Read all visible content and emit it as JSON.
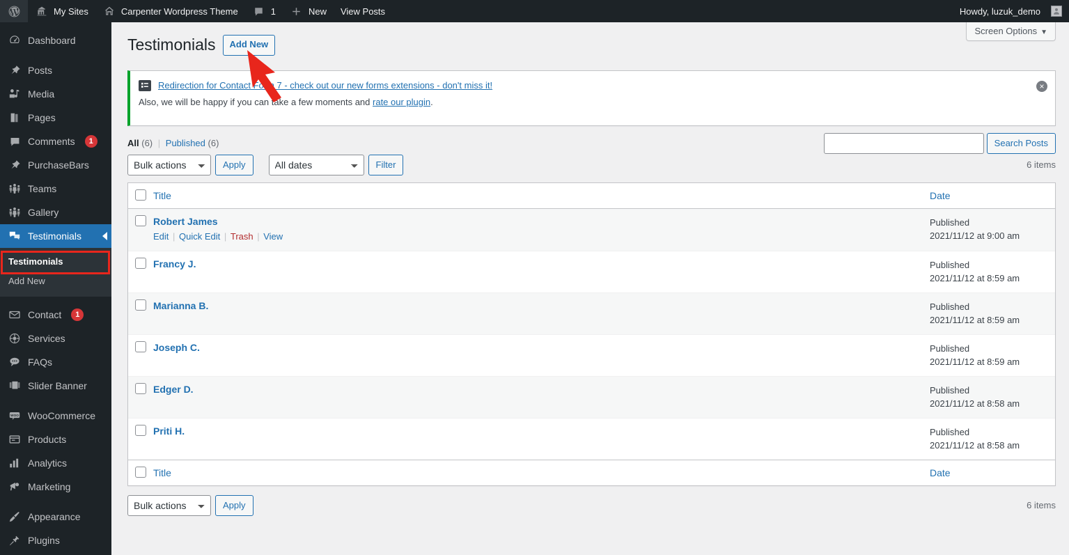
{
  "adminbar": {
    "wp_logo": "wordpress-logo-icon",
    "items": [
      {
        "label": "My Sites",
        "icon": "sites-icon"
      },
      {
        "label": "Carpenter Wordpress Theme",
        "icon": "home-icon"
      },
      {
        "label": "1",
        "icon": "comment-bubble-icon"
      },
      {
        "label": "New",
        "icon": "plus-icon"
      },
      {
        "label": "View Posts",
        "icon": ""
      }
    ],
    "howdy": "Howdy, luzuk_demo",
    "avatar": "user-avatar-icon"
  },
  "sidebar": {
    "items": [
      {
        "label": "Dashboard",
        "icon": "dashboard-icon",
        "badge": "",
        "current": false
      },
      {
        "label": "Posts",
        "icon": "pin-icon",
        "badge": "",
        "current": false
      },
      {
        "label": "Media",
        "icon": "media-icon",
        "badge": "",
        "current": false
      },
      {
        "label": "Pages",
        "icon": "pages-icon",
        "badge": "",
        "current": false
      },
      {
        "label": "Comments",
        "icon": "comment-bubble-icon",
        "badge": "1",
        "current": false
      },
      {
        "label": "PurchaseBars",
        "icon": "pin-icon",
        "badge": "",
        "current": false
      },
      {
        "label": "Teams",
        "icon": "groups-icon",
        "badge": "",
        "current": false
      },
      {
        "label": "Gallery",
        "icon": "groups-icon",
        "badge": "",
        "current": false
      },
      {
        "label": "Testimonials",
        "icon": "testimonials-icon",
        "badge": "",
        "current": true
      },
      {
        "label": "Contact",
        "icon": "email-icon",
        "badge": "1",
        "current": false
      },
      {
        "label": "Services",
        "icon": "services-icon",
        "badge": "",
        "current": false
      },
      {
        "label": "FAQs",
        "icon": "faq-icon",
        "badge": "",
        "current": false
      },
      {
        "label": "Slider Banner",
        "icon": "slider-icon",
        "badge": "",
        "current": false
      },
      {
        "label": "WooCommerce",
        "icon": "woocommerce-icon",
        "badge": "",
        "current": false
      },
      {
        "label": "Products",
        "icon": "products-icon",
        "badge": "",
        "current": false
      },
      {
        "label": "Analytics",
        "icon": "analytics-bars-icon",
        "badge": "",
        "current": false
      },
      {
        "label": "Marketing",
        "icon": "megaphone-icon",
        "badge": "",
        "current": false
      },
      {
        "label": "Appearance",
        "icon": "paintbrush-icon",
        "badge": "",
        "current": false
      },
      {
        "label": "Plugins",
        "icon": "plug-icon",
        "badge": "",
        "current": false
      }
    ],
    "submenu": [
      {
        "label": "Testimonials",
        "current": true
      },
      {
        "label": "Add New",
        "current": false
      }
    ],
    "highlight_color": "#e8261c"
  },
  "screen_options": {
    "label": "Screen Options",
    "caret": "▼"
  },
  "page": {
    "title": "Testimonials",
    "add_new_label": "Add New"
  },
  "notice": {
    "icon": "contact-form-7-icon",
    "link_text": "Redirection for Contact Form 7 - check out our new forms extensions - don't miss it!",
    "line2_prefix": "Also, we will be happy if you can take a few moments and ",
    "line2_link": "rate our plugin",
    "line2_suffix": ".",
    "dismiss": "×",
    "accent_color": "#00a32a"
  },
  "views": {
    "all_label": "All",
    "all_count": "(6)",
    "separator": "|",
    "published_label": "Published",
    "published_count": "(6)"
  },
  "filters": {
    "bulk_actions": "Bulk actions",
    "apply_label": "Apply",
    "all_dates": "All dates",
    "filter_label": "Filter"
  },
  "search": {
    "value": "",
    "placeholder": "",
    "button_label": "Search Posts"
  },
  "counts": {
    "items_top": "6 items",
    "items_bottom": "6 items"
  },
  "table": {
    "columns": {
      "title": "Title",
      "date": "Date"
    },
    "row_actions": {
      "edit": "Edit",
      "quick_edit": "Quick Edit",
      "trash": "Trash",
      "view": "View",
      "sep": "|"
    },
    "rows": [
      {
        "title": "Robert James",
        "status": "Published",
        "date": "2021/11/12 at 9:00 am",
        "show_actions": true
      },
      {
        "title": "Francy J.",
        "status": "Published",
        "date": "2021/11/12 at 8:59 am",
        "show_actions": false
      },
      {
        "title": "Marianna B.",
        "status": "Published",
        "date": "2021/11/12 at 8:59 am",
        "show_actions": false
      },
      {
        "title": "Joseph C.",
        "status": "Published",
        "date": "2021/11/12 at 8:59 am",
        "show_actions": false
      },
      {
        "title": "Edger D.",
        "status": "Published",
        "date": "2021/11/12 at 8:58 am",
        "show_actions": false
      },
      {
        "title": "Priti H.",
        "status": "Published",
        "date": "2021/11/12 at 8:58 am",
        "show_actions": false
      }
    ]
  },
  "bottom_filters": {
    "bulk_actions": "Bulk actions",
    "apply_label": "Apply"
  },
  "annotation": {
    "arrow_color": "#e8261c",
    "target": "add-new-button"
  }
}
